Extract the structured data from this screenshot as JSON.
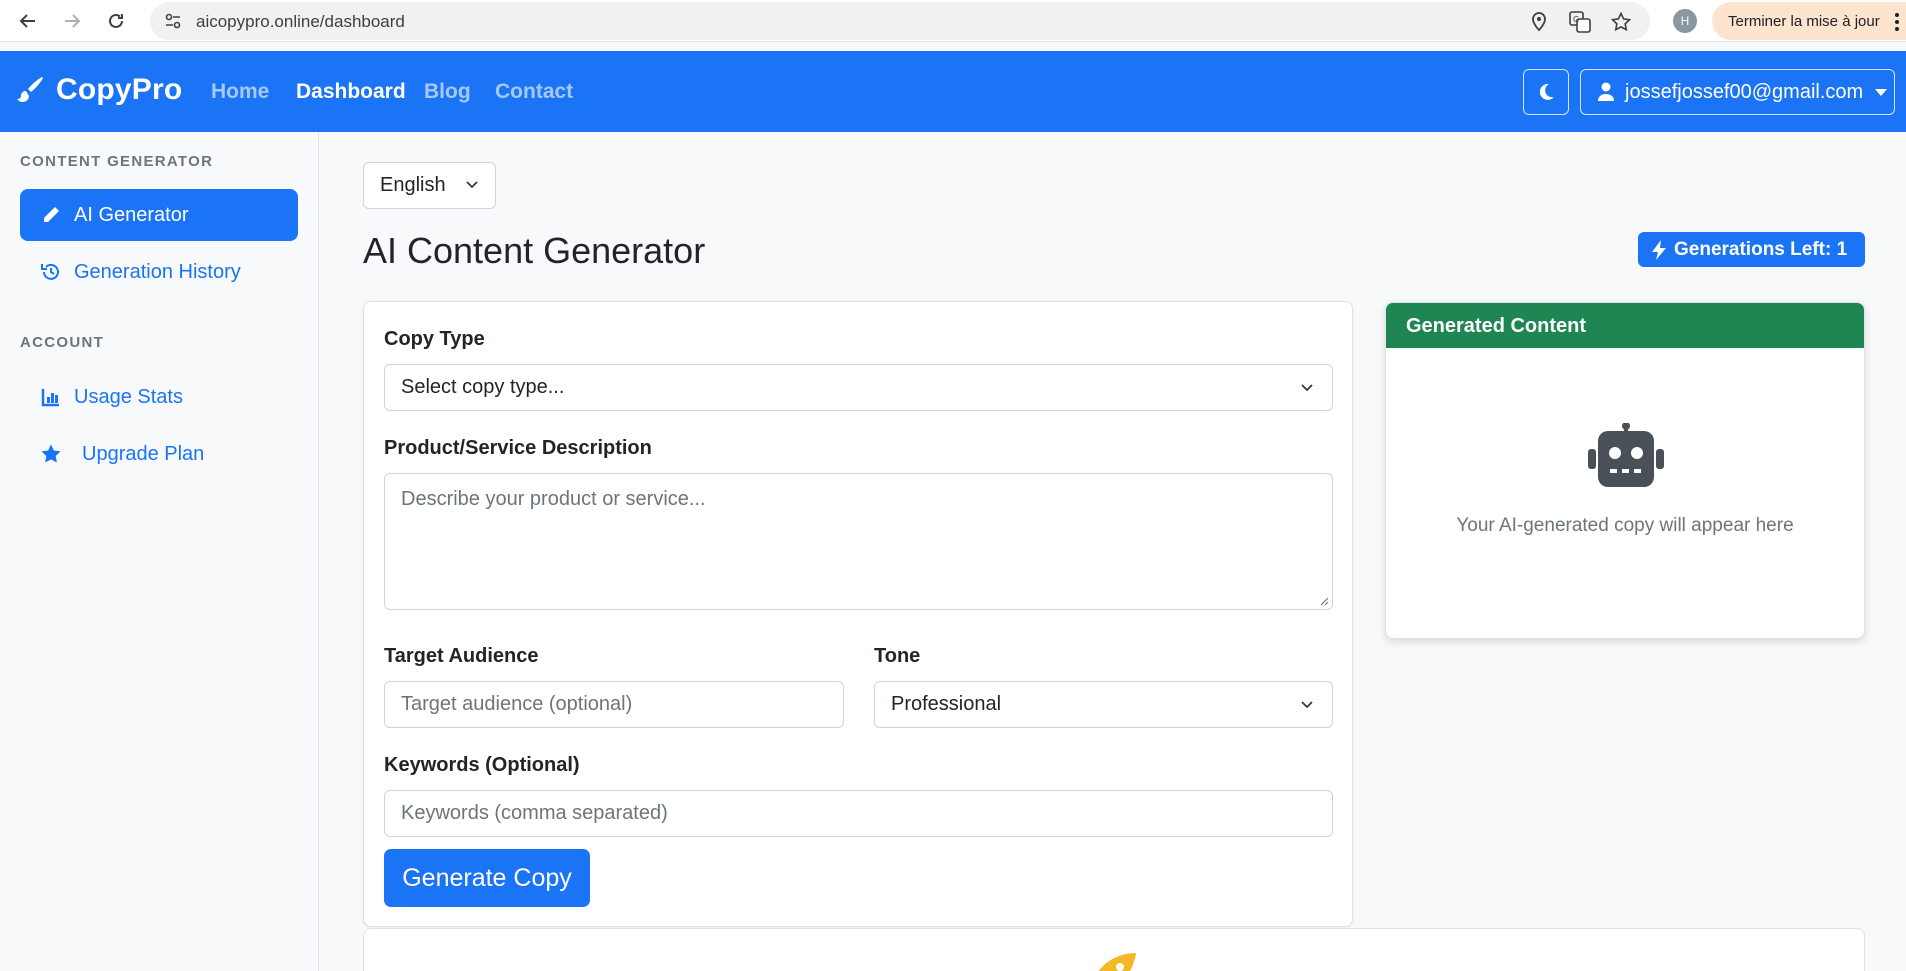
{
  "browser": {
    "url": "aicopypro.online/dashboard",
    "profile_initial": "H",
    "update_label": "Terminer la mise à jour"
  },
  "navbar": {
    "brand": "CopyPro",
    "links": [
      "Home",
      "Dashboard",
      "Blog",
      "Contact"
    ],
    "active_link": "Dashboard",
    "user_email": "jossefjossef00@gmail.com"
  },
  "sidebar": {
    "sections": [
      {
        "heading": "CONTENT GENERATOR",
        "items": [
          {
            "label": "AI Generator",
            "icon": "pencil-icon",
            "active": true
          },
          {
            "label": "Generation History",
            "icon": "history-icon",
            "active": false
          }
        ]
      },
      {
        "heading": "ACCOUNT",
        "items": [
          {
            "label": "Usage Stats",
            "icon": "chart-icon",
            "active": false
          },
          {
            "label": "Upgrade Plan",
            "icon": "star-icon",
            "active": false
          }
        ]
      }
    ]
  },
  "main": {
    "language": "English",
    "title": "AI Content Generator",
    "generations_left": "Generations Left: 1",
    "form": {
      "copy_type_label": "Copy Type",
      "copy_type_placeholder": "Select copy type...",
      "description_label": "Product/Service Description",
      "description_placeholder": "Describe your product or service...",
      "audience_label": "Target Audience",
      "audience_placeholder": "Target audience (optional)",
      "tone_label": "Tone",
      "tone_value": "Professional",
      "keywords_label": "Keywords (Optional)",
      "keywords_placeholder": "Keywords (comma separated)",
      "submit_label": "Generate Copy"
    },
    "output": {
      "header": "Generated Content",
      "placeholder": "Your AI-generated copy will appear here"
    }
  },
  "colors": {
    "primary": "#1b74f5",
    "success": "#1e8553",
    "muted": "#6c757d"
  }
}
